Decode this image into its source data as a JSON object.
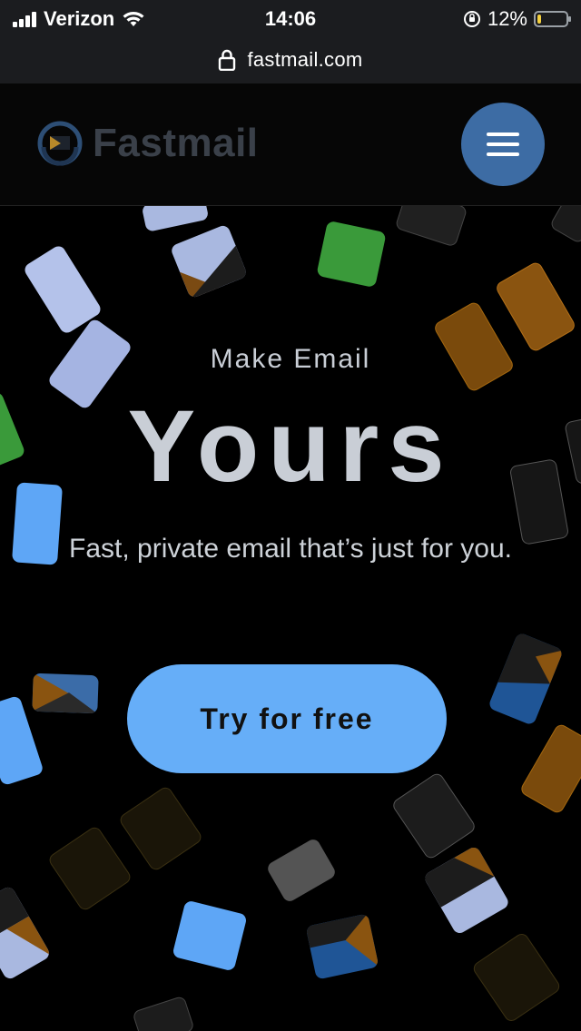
{
  "status_bar": {
    "carrier": "Verizon",
    "time": "14:06",
    "battery_percent": "12%",
    "battery_level": 0.12
  },
  "address_bar": {
    "url": "fastmail.com"
  },
  "header": {
    "logo_text": "Fastmail",
    "menu_icon": "hamburger-menu-icon"
  },
  "hero": {
    "eyebrow": "Make Email",
    "headline": "Yours",
    "subtitle": "Fast, private email that’s just for you.",
    "cta_label": "Try for free"
  },
  "colors": {
    "accent": "#66aef8",
    "menu_button": "#3d6ca4",
    "headline_text": "#c9ced6",
    "background": "#000000"
  }
}
